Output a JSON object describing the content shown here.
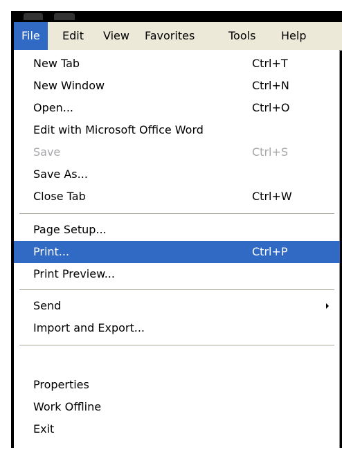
{
  "menubar": {
    "items": [
      {
        "label": "File",
        "active": true
      },
      {
        "label": "Edit"
      },
      {
        "label": "View"
      },
      {
        "label": "Favorites"
      },
      {
        "label": "Tools"
      },
      {
        "label": "Help"
      }
    ]
  },
  "menu": {
    "items": [
      {
        "label": "New Tab",
        "shortcut": "Ctrl+T"
      },
      {
        "label": "New Window",
        "shortcut": "Ctrl+N"
      },
      {
        "label": "Open...",
        "shortcut": "Ctrl+O"
      },
      {
        "label": "Edit with Microsoft Office Word",
        "shortcut": ""
      },
      {
        "label": "Save",
        "shortcut": "Ctrl+S",
        "disabled": true
      },
      {
        "label": "Save As...",
        "shortcut": ""
      },
      {
        "label": "Close Tab",
        "shortcut": "Ctrl+W"
      },
      {
        "label": "Page Setup...",
        "shortcut": ""
      },
      {
        "label": "Print...",
        "shortcut": "Ctrl+P",
        "highlighted": true
      },
      {
        "label": "Print Preview...",
        "shortcut": ""
      },
      {
        "label": "Send",
        "shortcut": "",
        "submenu": true
      },
      {
        "label": "Import and Export...",
        "shortcut": ""
      },
      {
        "label": "Properties",
        "shortcut": ""
      },
      {
        "label": "Work Offline",
        "shortcut": ""
      },
      {
        "label": "Exit",
        "shortcut": ""
      }
    ]
  },
  "colors": {
    "highlight": "#316ac5",
    "menubar_bg": "#ece9d8",
    "disabled_text": "#a7a6aa",
    "frame": "#000000"
  }
}
